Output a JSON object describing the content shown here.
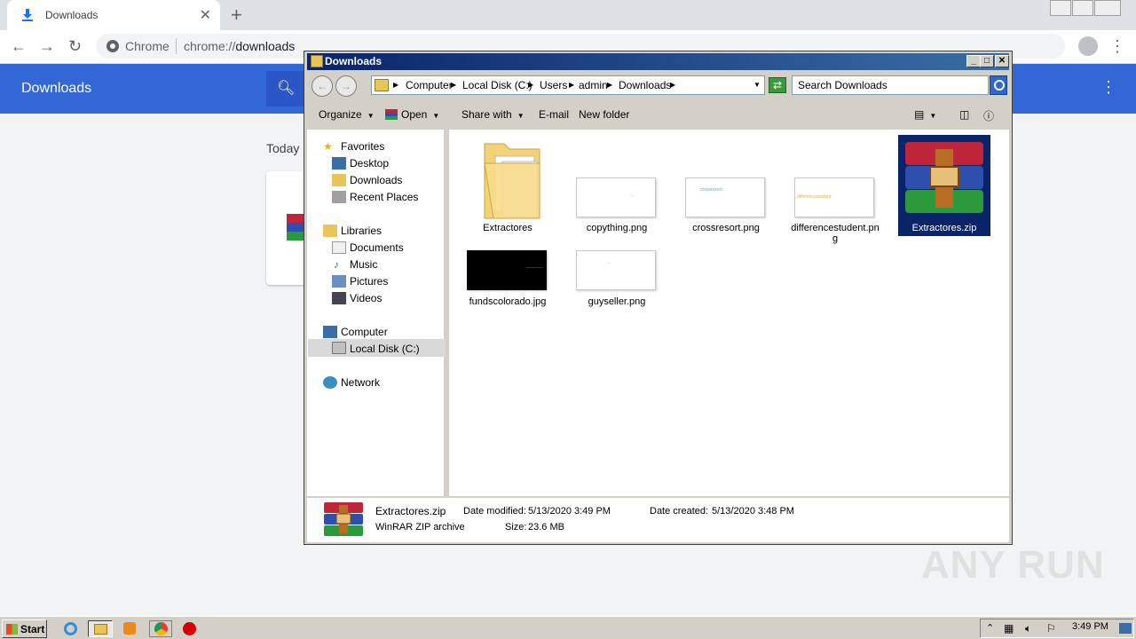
{
  "chrome": {
    "tab_title": "Downloads",
    "omnibox_chip": "Chrome",
    "url_scheme": "chrome://",
    "url_path": "downloads",
    "header_title": "Downloads",
    "section_today": "Today"
  },
  "explorer": {
    "title": "Downloads",
    "breadcrumbs": [
      "Computer",
      "Local Disk (C:)",
      "Users",
      "admin",
      "Downloads"
    ],
    "search_placeholder": "Search Downloads",
    "commands": {
      "organize": "Organize",
      "open": "Open",
      "share_with": "Share with",
      "email": "E-mail",
      "new_folder": "New folder"
    },
    "nav": {
      "favorites": "Favorites",
      "desktop": "Desktop",
      "downloads": "Downloads",
      "recent": "Recent Places",
      "libraries": "Libraries",
      "documents": "Documents",
      "music": "Music",
      "pictures": "Pictures",
      "videos": "Videos",
      "computer": "Computer",
      "local_disk": "Local Disk (C:)",
      "network": "Network"
    },
    "files": [
      {
        "name": "Extractores",
        "thumb_text": ""
      },
      {
        "name": "copything.png",
        "thumb_text": "..."
      },
      {
        "name": "crossresort.png",
        "thumb_text": "crossresort"
      },
      {
        "name": "differencestudent.png",
        "thumb_text": "differencestudent"
      },
      {
        "name": "Extractores.zip",
        "thumb_text": ""
      },
      {
        "name": "fundscolorado.jpg",
        "thumb_text": ""
      },
      {
        "name": "guyseller.png",
        "thumb_text": "..."
      }
    ],
    "details": {
      "name": "Extractores.zip",
      "type": "WinRAR ZIP archive",
      "modified_label": "Date modified:",
      "modified": "5/13/2020 3:49 PM",
      "created_label": "Date created:",
      "created": "5/13/2020 3:48 PM",
      "size_label": "Size:",
      "size": "23.6 MB"
    }
  },
  "taskbar": {
    "start": "Start",
    "clock": "3:49 PM"
  },
  "watermark": "ANY RUN"
}
